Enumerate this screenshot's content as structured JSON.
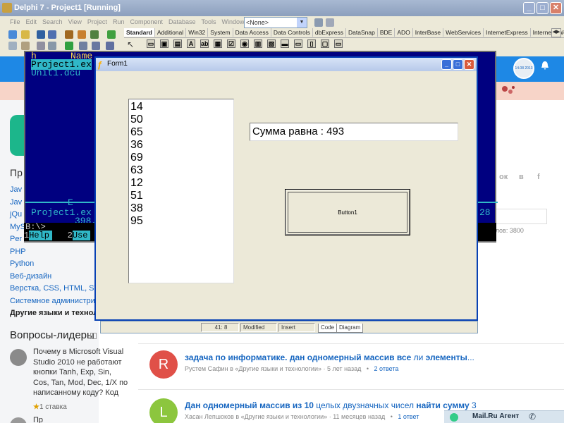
{
  "ide": {
    "title": "Delphi 7 - Project1 [Running]",
    "menu": [
      "File",
      "Edit",
      "Search",
      "View",
      "Project",
      "Run",
      "Component",
      "Database",
      "Tools",
      "Window",
      "Help"
    ],
    "combo_value": "<None>",
    "palette_tabs": [
      "Standard",
      "Additional",
      "Win32",
      "System",
      "Data Access",
      "Data Controls",
      "dbExpress",
      "DataSnap",
      "BDE",
      "ADO",
      "InterBase",
      "WebServices",
      "InternetExpress",
      "Internet",
      "WebSn"
    ],
    "active_tab": "Standard",
    "palette_components": [
      "▭",
      "▣",
      "▤",
      "A",
      "ab",
      "▦",
      "☑",
      "◉",
      "▥",
      "▧",
      "▬",
      "▭",
      "▯",
      "▢",
      "▭"
    ]
  },
  "dos": {
    "lines": [
      "h",
      "Name",
      "Project1.ex",
      "Unit1.dcu"
    ],
    "footer_left": "Project1.ex",
    "footer_size": "398,",
    "footer_e": "E",
    "footer_right": "28",
    "prompt": "B:\\>",
    "fkeys": [
      {
        "n": "1",
        "l": "Help"
      },
      {
        "n": "2",
        "l": "Use"
      }
    ]
  },
  "form1": {
    "title": "Form1",
    "list_values": [
      "14",
      "50",
      "65",
      "36",
      "69",
      "63",
      "12",
      "51",
      "38",
      "95"
    ],
    "sum_text": "Сумма равна : 493",
    "button_label": "Button1"
  },
  "status_strip": {
    "position": "41:  8",
    "state": "Modified",
    "mode": "Insert",
    "tabs": [
      "Code",
      "Diagram"
    ]
  },
  "web": {
    "date_badge": "14.08 2013",
    "side_letter": "Пр",
    "side_items": [
      "Jav",
      "Jav",
      "jQu",
      "MyS",
      "Per",
      "PHP",
      "Python",
      "Веб-дизайн",
      "Верстка, CSS, HTML, SVG",
      "Системное администрир",
      "Другие языки и техноло"
    ],
    "leaders_title": "Вопросы-лидеры",
    "leader_question": "Почему в Microsoft Visual Studio 2010 не работают кнопки Tanh, Exp, Sin, Cos, Tan, Mod, Dec, 1/X по написанному коду? Код",
    "leader_stake": "1 ставка",
    "leader2_author": "Пр",
    "social": [
      "ок",
      "в",
      "f"
    ],
    "char_count": "имволов: 3800",
    "feed": [
      {
        "avatar_letter": "R",
        "avatar_color": "#e05048",
        "title_bold": "задача по информатике. дан одномерный массив все",
        "title_normal": " ли ",
        "title_bold2": "элементы",
        "title_tail": "...",
        "author": "Рустем Сафин в «Другие языки и технологии»",
        "time": "5 лет назад",
        "answers": "2 ответа"
      },
      {
        "avatar_letter": "L",
        "avatar_color": "#8cc63e",
        "title_bold": "Дан одномерный массив из 10",
        "title_normal": " целых двузначных чисел ",
        "title_bold2": "найти сумму",
        "title_tail": " 3",
        "author": "Хасан Лепшоков в «Другие языки и технологии»",
        "time": "11 месяцев назад",
        "answers": "1 ответ"
      }
    ],
    "agent_label": "Mail.Ru Агент"
  },
  "colors": {
    "ide_titlebar": "#a8b9d2",
    "dos_bg": "#000080",
    "dos_text": "#30b8c8",
    "form_border": "#0841b4",
    "web_nav": "#1e88e5"
  }
}
